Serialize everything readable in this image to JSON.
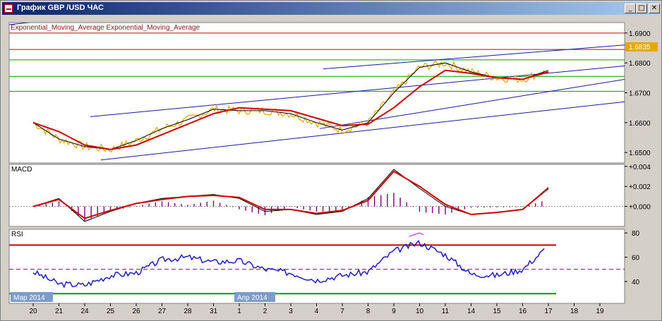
{
  "window": {
    "title": "График GBP /USD  ЧАС",
    "buttons": {
      "minimize": "_",
      "maximize": "□",
      "close": "✕"
    }
  },
  "main_panel": {
    "legend": "Exponential_Moving_Average Exponential_Moving_Average",
    "current_price": "1.6835",
    "y_ticks": [
      "1.6900",
      "1.6800",
      "1.6700",
      "1.6600",
      "1.6500"
    ],
    "colors": {
      "price": "#e6a800",
      "ema_fast": "#000000",
      "ema_slow": "#cc0000",
      "trend": "#1a1aa0",
      "level_red": "#cc0000",
      "level_green": "#00a000"
    }
  },
  "macd_panel": {
    "label": "MACD",
    "y_ticks": [
      "+0.004",
      "+0.002",
      "+0.000"
    ]
  },
  "rsi_panel": {
    "label": "RSI",
    "y_ticks": [
      "80",
      "60",
      "40"
    ],
    "levels": {
      "upper": 70,
      "mid": 50,
      "lower": 30
    }
  },
  "x_axis": {
    "day_labels": [
      "20",
      "21",
      "24",
      "25",
      "26",
      "27",
      "28",
      "31",
      "1",
      "2",
      "3",
      "4",
      "7",
      "8",
      "9",
      "10",
      "11",
      "14",
      "15",
      "16",
      "17",
      "18",
      "19"
    ],
    "month_markers": [
      "Мар 2014",
      "Апр 2014"
    ]
  },
  "chart_data": [
    {
      "type": "line",
      "title": "GBP/USD H1",
      "x": [
        "20",
        "21",
        "24",
        "25",
        "26",
        "27",
        "28",
        "31",
        "1",
        "2",
        "3",
        "4",
        "7",
        "8",
        "9",
        "10",
        "11",
        "14",
        "15",
        "16",
        "17"
      ],
      "series": [
        {
          "name": "Exponential_Moving_Average",
          "values": [
            1.66,
            1.6545,
            1.652,
            1.651,
            1.654,
            1.658,
            1.661,
            1.6645,
            1.664,
            1.664,
            1.663,
            1.66,
            1.6575,
            1.66,
            1.67,
            1.6785,
            1.68,
            1.677,
            1.675,
            1.6745,
            1.6775
          ]
        },
        {
          "name": "Exponential_Moving_Average",
          "values": [
            1.66,
            1.657,
            1.6525,
            1.651,
            1.6525,
            1.656,
            1.6595,
            1.663,
            1.665,
            1.6645,
            1.664,
            1.6615,
            1.659,
            1.6595,
            1.665,
            1.672,
            1.6775,
            1.6765,
            1.675,
            1.6745,
            1.677
          ]
        }
      ],
      "ylim": [
        1.6465,
        1.6935
      ],
      "grid": false,
      "legend": "top-left"
    },
    {
      "type": "line",
      "title": "MACD",
      "x": [
        "20",
        "21",
        "24",
        "25",
        "26",
        "27",
        "28",
        "31",
        "1",
        "2",
        "3",
        "4",
        "7",
        "8",
        "9",
        "10",
        "11",
        "14",
        "15",
        "16",
        "17"
      ],
      "series": [
        {
          "values": [
            0.0,
            0.0008,
            -0.0015,
            -0.0005,
            0.0003,
            0.0008,
            0.001,
            0.0012,
            0.0008,
            -0.0005,
            -0.0003,
            -0.0008,
            -0.0005,
            0.0008,
            0.0037,
            0.0018,
            0.0,
            -0.0008,
            -0.0006,
            -0.0003,
            0.0019
          ]
        },
        {
          "values": [
            0.0,
            0.0007,
            -0.0012,
            -0.0004,
            0.0003,
            0.0007,
            0.001,
            0.0011,
            0.0009,
            -0.0003,
            -0.0003,
            -0.0007,
            -0.0004,
            0.0006,
            0.0035,
            0.002,
            0.0002,
            -0.0008,
            -0.0006,
            -0.0003,
            0.0018
          ]
        }
      ],
      "ylim": [
        -0.002,
        0.0042
      ]
    },
    {
      "type": "line",
      "title": "RSI",
      "x": [
        "20",
        "21",
        "24",
        "25",
        "26",
        "27",
        "28",
        "31",
        "1",
        "2",
        "3",
        "4",
        "7",
        "8",
        "9",
        "10",
        "11",
        "14",
        "15",
        "16",
        "17"
      ],
      "series": [
        {
          "values": [
            48,
            38,
            37,
            45,
            47,
            58,
            60,
            56,
            57,
            50,
            47,
            41,
            45,
            48,
            65,
            72,
            62,
            46,
            45,
            50,
            69
          ]
        }
      ],
      "ylim": [
        22,
        83
      ]
    }
  ]
}
